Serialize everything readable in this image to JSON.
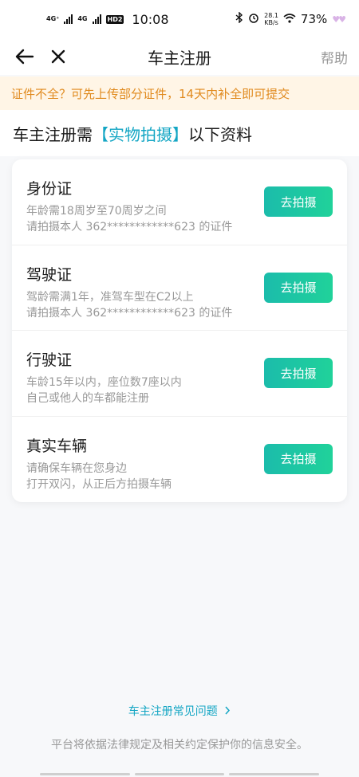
{
  "status_bar": {
    "net_tag_1": "4G⁺",
    "net_tag_2": "4G",
    "hd": "HD2",
    "time": "10:08",
    "speed_value": "28.1",
    "speed_unit": "KB/s",
    "battery": "73%"
  },
  "nav": {
    "title": "车主注册",
    "help": "帮助"
  },
  "notice": "证件不全？可先上传部分证件，14天内补全即可提交",
  "heading": {
    "prefix": "车主注册需",
    "highlight": "【实物拍摄】",
    "suffix": "以下资料"
  },
  "items": [
    {
      "title": "身份证",
      "line1": "年龄需18周岁至70周岁之间",
      "line2": "请拍摄本人 362************623 的证件",
      "button": "去拍摄"
    },
    {
      "title": "驾驶证",
      "line1": "驾龄需满1年，准驾车型在C2以上",
      "line2": "请拍摄本人 362************623 的证件",
      "button": "去拍摄"
    },
    {
      "title": "行驶证",
      "line1": "车龄15年以内，座位数7座以内",
      "line2": "自己或他人的车都能注册",
      "button": "去拍摄"
    },
    {
      "title": "真实车辆",
      "line1": "请确保车辆在您身边",
      "line2": "打开双闪，从正后方拍摄车辆",
      "button": "去拍摄"
    }
  ],
  "faq_link": "车主注册常见问题",
  "footer_note": "平台将依据法律规定及相关约定保护你的信息安全。",
  "colors": {
    "accent": "#14a6c4",
    "button_start": "#1bbcab",
    "button_end": "#20d29a",
    "notice_bg": "#fff5e6",
    "notice_text": "#e08a1e"
  }
}
